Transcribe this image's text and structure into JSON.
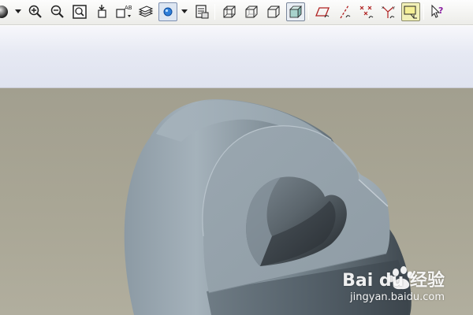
{
  "toolbar": {
    "icons": [
      "shading-sphere-icon",
      "dropdown-arrow-icon",
      "zoom-in-icon",
      "zoom-out-icon",
      "refit-icon",
      "reorient-icon",
      "saved-views-icon",
      "layers-icon",
      "spin-center-icon",
      "dropdown-arrow-icon",
      "view-manager-icon",
      "wireframe-icon",
      "hidden-line-icon",
      "no-hidden-icon",
      "shaded-icon",
      "datum-planes-icon",
      "datum-axes-icon",
      "datum-points-icon",
      "coordinate-systems-icon",
      "annotation-display-icon",
      "context-help-icon"
    ],
    "active": [
      "spin-center-icon",
      "shaded-icon",
      "annotation-display-icon"
    ]
  },
  "colors": {
    "viewport_bg": "#a8a594",
    "part_light": "#a9b6bf",
    "part_mid": "#8b98a2",
    "part_dark": "#4a535a",
    "message_area": "#e6e9f3"
  },
  "watermark": {
    "brand": "Bai du 经验",
    "url": "jingyan.baidu.com"
  }
}
